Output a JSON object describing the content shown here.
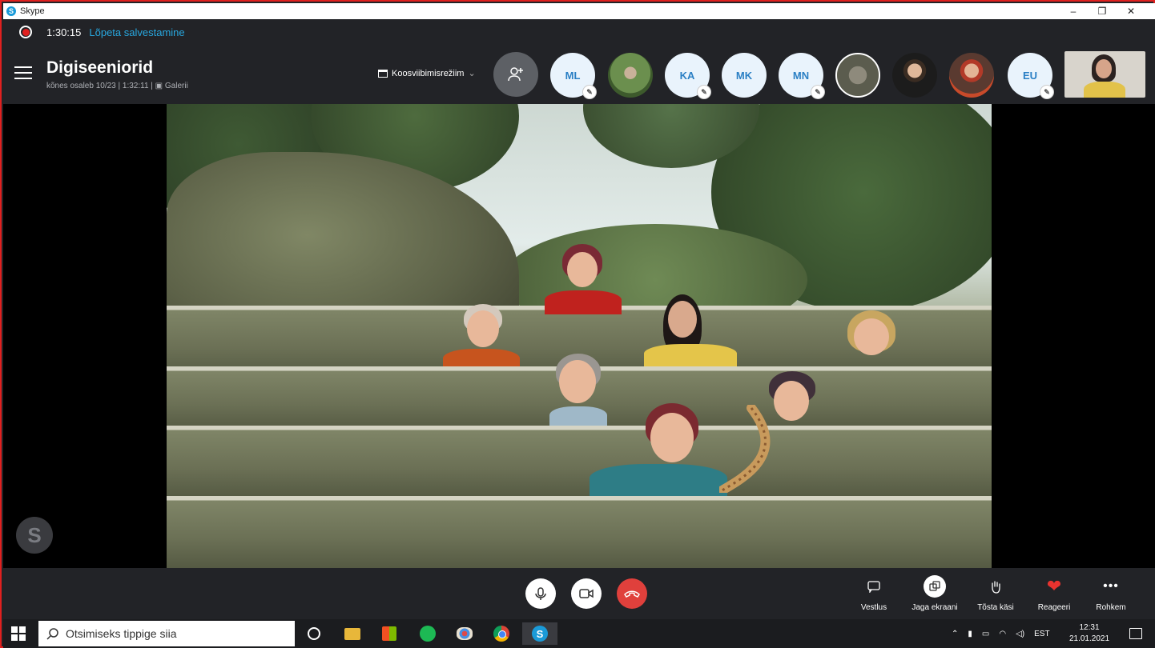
{
  "window": {
    "title": "Skype",
    "minimize_icon": "–",
    "maximize_icon": "❐",
    "close_icon": "✕"
  },
  "recording": {
    "time": "1:30:15",
    "stop_label": "Lõpeta salvestamine"
  },
  "call": {
    "title": "Digiseeniorid",
    "subtitle": "kõnes osaleb 10/23 | 1:32:11 | ▣ Galerii",
    "mode_label": "Koosviibimisrežiim",
    "mode_chevron": "⌄"
  },
  "participants": [
    {
      "initials": "ML",
      "muted": true
    },
    {
      "initials": "",
      "muted": false,
      "photo": true
    },
    {
      "initials": "KA",
      "muted": true
    },
    {
      "initials": "MK",
      "muted": false
    },
    {
      "initials": "MN",
      "muted": true
    },
    {
      "initials": "",
      "muted": false,
      "photo": true
    },
    {
      "initials": "",
      "muted": false,
      "photo": true
    },
    {
      "initials": "",
      "muted": false,
      "photo": true
    },
    {
      "initials": "EU",
      "muted": true
    }
  ],
  "actions": {
    "chat": "Vestlus",
    "share": "Jaga ekraani",
    "raise": "Tõsta käsi",
    "react": "Reageeri",
    "more": "Rohkem"
  },
  "taskbar": {
    "search_placeholder": "Otsimiseks tippige siia",
    "language": "EST",
    "time": "12:31",
    "date": "21.01.2021"
  },
  "colors": {
    "accent": "#28a8e0",
    "record": "#e0201f",
    "hangup": "#e0403c",
    "avatar_text": "#2a7fc4"
  }
}
